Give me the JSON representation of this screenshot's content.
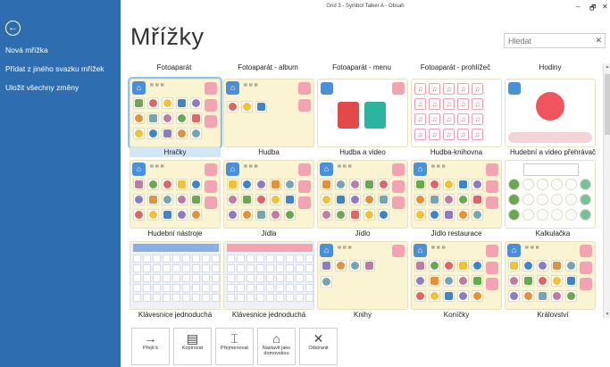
{
  "window": {
    "title": "Grid 3 - Symbol Talker A - Obsah",
    "minimize": "–",
    "maximize": "🗗",
    "close": "✕"
  },
  "sidebar": {
    "back_icon": "←",
    "items": [
      {
        "label": "Nová mřížka"
      },
      {
        "label": "Přidat z jiného svazku mřížek"
      },
      {
        "label": "Uložit všechny změny"
      }
    ]
  },
  "page": {
    "title": "Mřížky"
  },
  "search": {
    "placeholder": "Hledat",
    "clear": "✕"
  },
  "top_labels": [
    "Fotoaparát",
    "Fotoaparát - album",
    "Fotoaparát - menu",
    "Fotoaparát - prohlížeč",
    "Hodiny"
  ],
  "rows": [
    [
      {
        "label": "Hračky",
        "kind": "grid-icons",
        "selected": true
      },
      {
        "label": "Hudba",
        "kind": "sparse"
      },
      {
        "label": "Hudba a video",
        "kind": "media"
      },
      {
        "label": "Hudba-knihovna",
        "kind": "music-lib"
      },
      {
        "label": "Hudební a video přehrávač",
        "kind": "player"
      }
    ],
    [
      {
        "label": "Hudební nástroje",
        "kind": "grid-icons"
      },
      {
        "label": "Jídla",
        "kind": "grid-icons"
      },
      {
        "label": "Jídlo",
        "kind": "grid-icons"
      },
      {
        "label": "Jídlo restaurace",
        "kind": "grid-icons"
      },
      {
        "label": "Kalkulačka",
        "kind": "calc"
      }
    ],
    [
      {
        "label": "Klávesnice jednoduchá",
        "kind": "keyboard-a"
      },
      {
        "label": "Klávesnice jednoduchá",
        "kind": "keyboard-b"
      },
      {
        "label": "Knihy",
        "kind": "sparse2"
      },
      {
        "label": "Koníčky",
        "kind": "grid-icons"
      },
      {
        "label": "Království",
        "kind": "grid-icons"
      }
    ]
  ],
  "toolbar": [
    {
      "label": "Přejít k",
      "icon": "→"
    },
    {
      "label": "Kopírovat",
      "icon": "▤"
    },
    {
      "label": "Přejmenovat",
      "icon": "⌶"
    },
    {
      "label": "Nastavit jako domovskou",
      "icon": "⌂"
    },
    {
      "label": "Odstranit",
      "icon": "✕"
    }
  ],
  "colors": {
    "sidebar": "#2e6eb0",
    "card": "#fbf4d3",
    "accent_blue": "#4a8fd9",
    "accent_pink": "#f3a3b1",
    "selected": "#8bc6ea"
  }
}
